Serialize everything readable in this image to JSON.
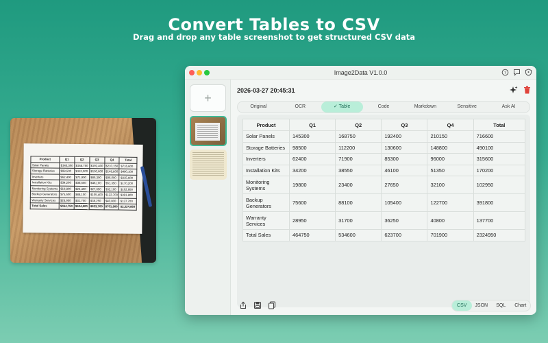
{
  "hero": {
    "title": "Convert Tables to CSV",
    "subtitle": "Drag and drop any table screenshot to get structured CSV data"
  },
  "photo": {
    "headers": [
      "Product",
      "Q1",
      "Q2",
      "Q3",
      "Q4",
      "Total"
    ],
    "rows": [
      [
        "Solar Panels",
        "$145,300",
        "$168,750",
        "$192,400",
        "$210,150",
        "$716,600"
      ],
      [
        "Storage Batteries",
        "$98,500",
        "$112,200",
        "$130,600",
        "$148,800",
        "$490,100"
      ],
      [
        "Inverters",
        "$62,400",
        "$71,900",
        "$85,300",
        "$96,000",
        "$315,600"
      ],
      [
        "Installation Kits",
        "$34,200",
        "$38,550",
        "$46,100",
        "$51,350",
        "$170,200"
      ],
      [
        "Monitoring Systems",
        "$19,800",
        "$23,400",
        "$27,650",
        "$32,100",
        "$102,950"
      ],
      [
        "Backup Generators",
        "$75,600",
        "$88,100",
        "$105,400",
        "$122,700",
        "$391,800"
      ],
      [
        "Warranty Services",
        "$28,950",
        "$31,700",
        "$36,250",
        "$40,800",
        "$137,700"
      ],
      [
        "Total Sales",
        "$464,750",
        "$534,600",
        "$623,700",
        "$701,900",
        "$2,324,950"
      ]
    ]
  },
  "window": {
    "title": "Image2Data V1.0.0",
    "icons": [
      "help-icon",
      "feedback-icon",
      "privacy-icon"
    ]
  },
  "main": {
    "timestamp": "2026-03-27 20:45:31",
    "tabs": [
      {
        "label": "Original",
        "active": false
      },
      {
        "label": "OCR",
        "active": false
      },
      {
        "label": "✓ Table",
        "active": true
      },
      {
        "label": "Code",
        "active": false
      },
      {
        "label": "Markdown",
        "active": false
      },
      {
        "label": "Sensitive",
        "active": false
      },
      {
        "label": "Ask AI",
        "active": false
      }
    ],
    "table": {
      "headers": [
        "Product",
        "Q1",
        "Q2",
        "Q3",
        "Q4",
        "Total"
      ],
      "rows": [
        [
          "Solar Panels",
          "145300",
          "168750",
          "192400",
          "210150",
          "716600"
        ],
        [
          "Storage Batteries",
          "98500",
          "112200",
          "130600",
          "148800",
          "490100"
        ],
        [
          "Inverters",
          "62400",
          "71900",
          "85300",
          "96000",
          "315600"
        ],
        [
          "Installation Kits",
          "34200",
          "38550",
          "46100",
          "51350",
          "170200"
        ],
        [
          "Monitoring Systems",
          "19800",
          "23400",
          "27650",
          "32100",
          "102950"
        ],
        [
          "Backup Generators",
          "75600",
          "88100",
          "105400",
          "122700",
          "391800"
        ],
        [
          "Warranty Services",
          "28950",
          "31700",
          "36250",
          "40800",
          "137700"
        ],
        [
          "Total Sales",
          "464750",
          "534600",
          "623700",
          "701900",
          "2324950"
        ]
      ]
    },
    "formats": [
      {
        "label": "CSV",
        "active": true
      },
      {
        "label": "JSON",
        "active": false
      },
      {
        "label": "SQL",
        "active": false
      },
      {
        "label": "Chart",
        "active": false
      }
    ]
  },
  "colors": {
    "accent": "#3fba96",
    "active_tab_bg": "#b9eed9",
    "delete": "#e0443c"
  }
}
